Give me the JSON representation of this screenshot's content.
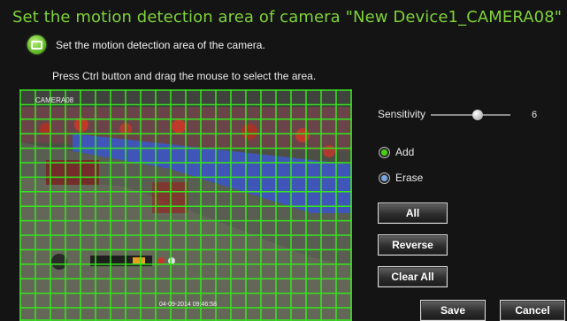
{
  "title": "Set the motion detection area of camera \"New Device1_CAMERA08\"",
  "subtitle": "Set the motion detection area of the camera.",
  "hint": "Press Ctrl button and drag the mouse to select the area.",
  "video": {
    "camera_name": "CAMERA08",
    "timestamp": "04-09-2014 09:46:58",
    "grid": {
      "columns": 22,
      "rows": 16,
      "line_color": "#35e51c",
      "all_cells_selected": true
    }
  },
  "sensitivity": {
    "label": "Sensitivity",
    "value": "6",
    "level": 0.6
  },
  "mode": {
    "options": [
      {
        "label": "Add",
        "selected": true,
        "color": "#46d20f"
      },
      {
        "label": "Erase",
        "selected": false,
        "color": "#7aa8e6"
      }
    ]
  },
  "buttons": {
    "all": "All",
    "reverse": "Reverse",
    "clear_all": "Clear All",
    "save": "Save",
    "cancel": "Cancel"
  },
  "colors": {
    "title": "#7ed23a",
    "background": "#141414",
    "grid": "#35e51c"
  }
}
